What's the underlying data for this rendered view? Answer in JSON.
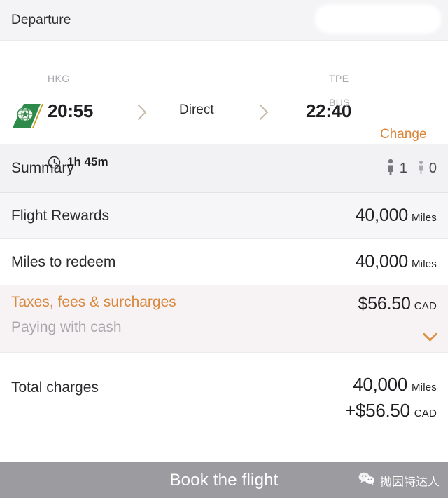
{
  "header": {
    "title": "Departure",
    "redaction": "redacted-area"
  },
  "flight": {
    "airline_logo": "eva-air-tail-logo",
    "departure_time": "20:55",
    "departure_code": "HKG",
    "arrival_time": "22:40",
    "arrival_code": "TPE",
    "arrival_terminal": "BUS",
    "stops_label": "Direct",
    "duration": "1h 45m",
    "duration_icon": "clock-icon",
    "arrow_icon": "chevron-right-icon",
    "change_label": "Change"
  },
  "summary": {
    "label": "Summary",
    "adult_icon": "adult-passenger-icon",
    "adult_count": "1",
    "child_icon": "child-passenger-icon",
    "child_count": "0"
  },
  "fare_rows": [
    {
      "label": "Flight Rewards",
      "value": "40,000",
      "unit": "Miles"
    },
    {
      "label": "Miles to redeem",
      "value": "40,000",
      "unit": "Miles"
    }
  ],
  "taxes": {
    "title": "Taxes, fees & surcharges",
    "subtitle": "Paying with cash",
    "amount": "$56.50",
    "currency": "CAD",
    "expand_icon": "chevron-down-icon"
  },
  "total": {
    "label": "Total charges",
    "miles_amount": "40,000",
    "miles_unit": "Miles",
    "cash_amount": "+$56.50",
    "cash_unit": "CAD"
  },
  "bottom": {
    "book_label": "Book the flight",
    "watermark_icon": "wechat-icon",
    "watermark_text": "抛因特达人"
  },
  "colors": {
    "accent_orange": "#d9883f",
    "header_bg": "#f4f4f6",
    "shade_bg": "#f6f6f8",
    "taxes_bg": "#f7f3f5",
    "disabled_button": "#9c9ca0",
    "eva_green": "#2e8a4a"
  }
}
